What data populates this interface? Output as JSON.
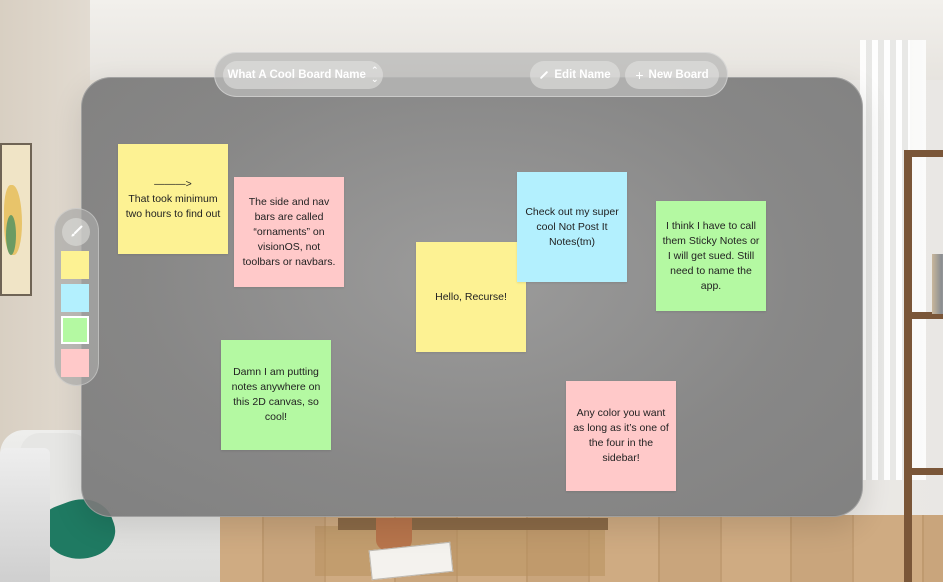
{
  "colors": {
    "yellow": "#fdf293",
    "pink": "#ffc9c9",
    "blue": "#b3f0fe",
    "green": "#b4f9a2"
  },
  "nav": {
    "board_picker_label": "What A Cool Board Name",
    "board_picker_icon": "chevron-up-down-icon",
    "edit_name_label": "Edit Name",
    "edit_name_icon": "pencil-icon",
    "new_board_label": "New Board",
    "new_board_icon": "plus-icon"
  },
  "sidebar": {
    "tool_icon": "paintbrush-icon",
    "swatches": [
      {
        "color": "yellow",
        "selected": false
      },
      {
        "color": "blue",
        "selected": false
      },
      {
        "color": "green",
        "selected": true
      },
      {
        "color": "pink",
        "selected": false
      }
    ]
  },
  "notes": [
    {
      "text": "———>\nThat took minimum two hours to find out",
      "color": "yellow"
    },
    {
      "text": "The side and nav bars are called “ornaments” on visionOS, not toolbars or navbars.",
      "color": "pink"
    },
    {
      "text": "Hello, Recurse!",
      "color": "yellow"
    },
    {
      "text": "Check out my super cool Not Post It Notes(tm)",
      "color": "blue"
    },
    {
      "text": "I think I have to call them Sticky Notes or I will get sued. Still need to name the app.",
      "color": "green"
    },
    {
      "text": "Damn I am putting notes anywhere on this 2D canvas, so cool!",
      "color": "green"
    },
    {
      "text": "Any color you want as long as it’s one of the four in the sidebar!",
      "color": "pink"
    }
  ]
}
